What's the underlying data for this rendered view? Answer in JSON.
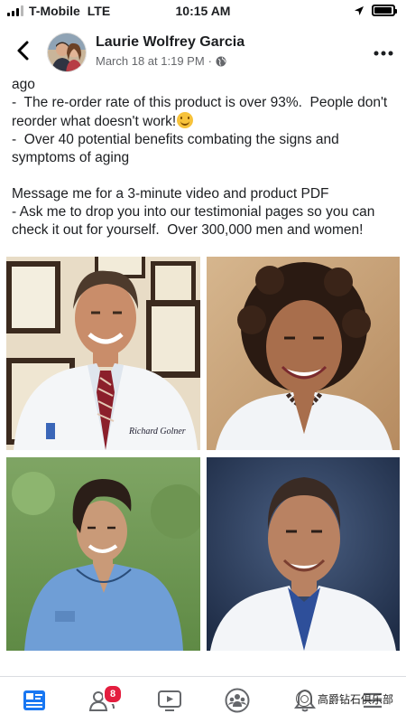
{
  "status_bar": {
    "carrier": "T-Mobile",
    "network": "LTE",
    "time": "10:15 AM",
    "signal_bars_active": 3,
    "signal_bars_total": 4,
    "battery_level": 0.95,
    "location_icon": "location-arrow-icon"
  },
  "header": {
    "back_icon": "chevron-left-icon",
    "author_name": "Laurie Wolfrey Garcia",
    "post_date": "March 18 at 1:19 PM",
    "meta_separator": "·",
    "privacy_icon": "globe-icon",
    "more_icon": "ellipsis-icon"
  },
  "post": {
    "line_0": "ago",
    "line_1": "-  The re-order rate of this product is over 93%.  People don't reorder what doesn't work!",
    "emoji_icon": "smiling-face-icon",
    "line_2": "-  Over 40 potential benefits combating the signs and symptoms of aging",
    "line_3": "Message me for a 3-minute video and product PDF",
    "line_4": "- Ask me to drop you into our testimonial pages so you can check it out for yourself.  Over 300,000 men and women!"
  },
  "photos": {
    "photo_1_coat_signature": "Richard Golner"
  },
  "tab_bar": {
    "tabs": [
      {
        "icon": "news-feed-icon",
        "active": true
      },
      {
        "icon": "friends-icon",
        "badge": "8"
      },
      {
        "icon": "watch-icon"
      },
      {
        "icon": "groups-icon"
      },
      {
        "icon": "notifications-icon"
      },
      {
        "icon": "menu-icon"
      }
    ]
  },
  "watermark": {
    "text": "高爵钻石俱乐部"
  },
  "colors": {
    "facebook_blue": "#1877f2",
    "badge_red": "#e41e3f",
    "meta_gray": "#65676b"
  }
}
